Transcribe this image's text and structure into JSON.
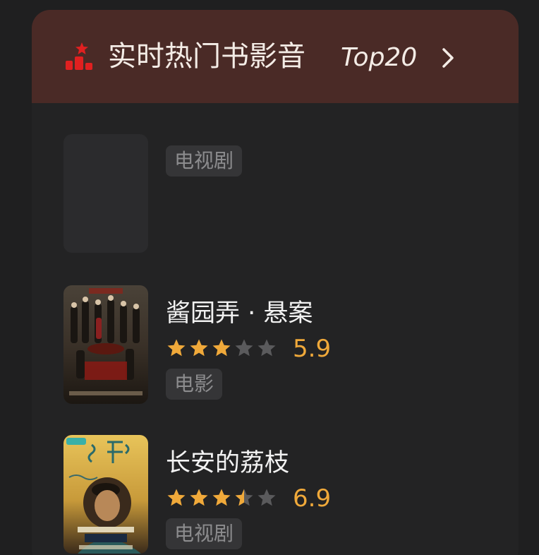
{
  "header": {
    "title": "实时热门书影音",
    "top_label": "Top20",
    "chevron_icon": "chevron-right-icon",
    "rank_icon": "ranking-podium-icon",
    "background_color": "#4a2a26",
    "accent_color": "#e02020"
  },
  "items": [
    {
      "title": "",
      "rating": null,
      "score": "",
      "tag": "电视剧",
      "poster": "empty"
    },
    {
      "title": "酱园弄 · 悬案",
      "rating": 3.0,
      "score": "5.9",
      "tag": "电影",
      "poster": "dark-period-drama-poster"
    },
    {
      "title": "长安的荔枝",
      "rating": 3.5,
      "score": "6.9",
      "tag": "电视剧",
      "poster": "yellow-period-drama-poster"
    }
  ],
  "rating_color": "#f0a93a",
  "rating_empty_color": "#5a5a5c"
}
